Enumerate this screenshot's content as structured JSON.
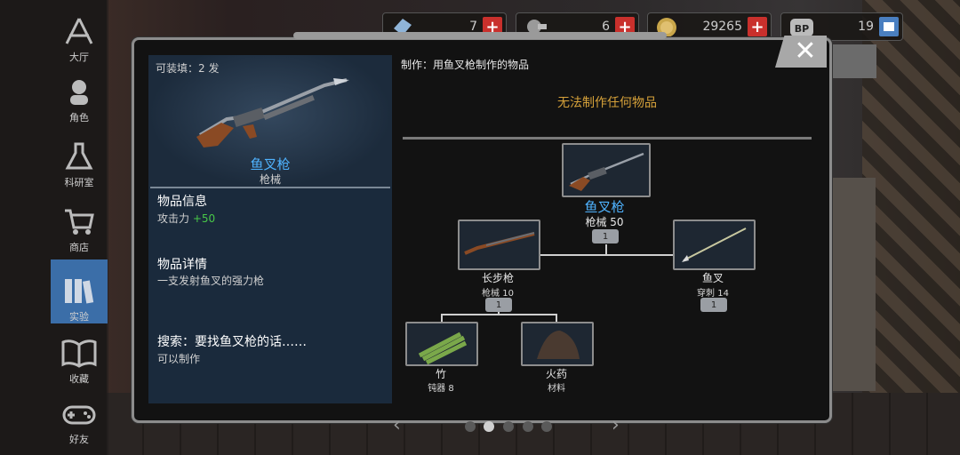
{
  "sidebar": {
    "items": [
      {
        "label": "大厅",
        "icon": "lobby-icon"
      },
      {
        "label": "角色",
        "icon": "character-icon"
      },
      {
        "label": "科研室",
        "icon": "flask-icon"
      },
      {
        "label": "商店",
        "icon": "cart-icon"
      },
      {
        "label": "实验",
        "icon": "books-icon"
      },
      {
        "label": "收藏",
        "icon": "open-book-icon"
      },
      {
        "label": "好友",
        "icon": "gamepad-icon"
      }
    ],
    "active_index": 4
  },
  "resources": [
    {
      "icon": "crystal-icon",
      "value": "7"
    },
    {
      "icon": "component-icon",
      "value": "6"
    },
    {
      "icon": "coin-icon",
      "value": "29265"
    },
    {
      "icon": "bp-icon",
      "value": "19"
    }
  ],
  "item": {
    "capacity": "可装填：2 发",
    "name": "鱼叉枪",
    "category": "枪械",
    "info_heading": "物品信息",
    "stat_label": "攻击力",
    "stat_value": "+50",
    "detail_heading": "物品详情",
    "detail_text": "一支发射鱼叉的强力枪",
    "search_heading": "搜索：要找鱼叉枪的话……",
    "search_text": "可以制作"
  },
  "craft": {
    "header": "制作：用鱼叉枪制作的物品",
    "empty_message": "无法制作任何物品"
  },
  "recipe": {
    "root": {
      "name": "鱼叉枪",
      "stat": "枪械 50",
      "count": "1"
    },
    "left": {
      "name": "长步枪",
      "stat": "枪械 10",
      "count": "1"
    },
    "right": {
      "name": "鱼叉",
      "stat": "穿刺 14",
      "count": "1"
    },
    "left_children": [
      {
        "name": "竹",
        "stat": "钝器 8"
      },
      {
        "name": "火药",
        "stat": "材料"
      }
    ]
  },
  "pager": {
    "total": 5,
    "current": 1
  },
  "colors": {
    "accent_blue": "#4fb3ff",
    "gold": "#d7a23a",
    "green": "#48c848",
    "plus_red": "#c9302c",
    "active_tab": "#3b6ea8"
  }
}
